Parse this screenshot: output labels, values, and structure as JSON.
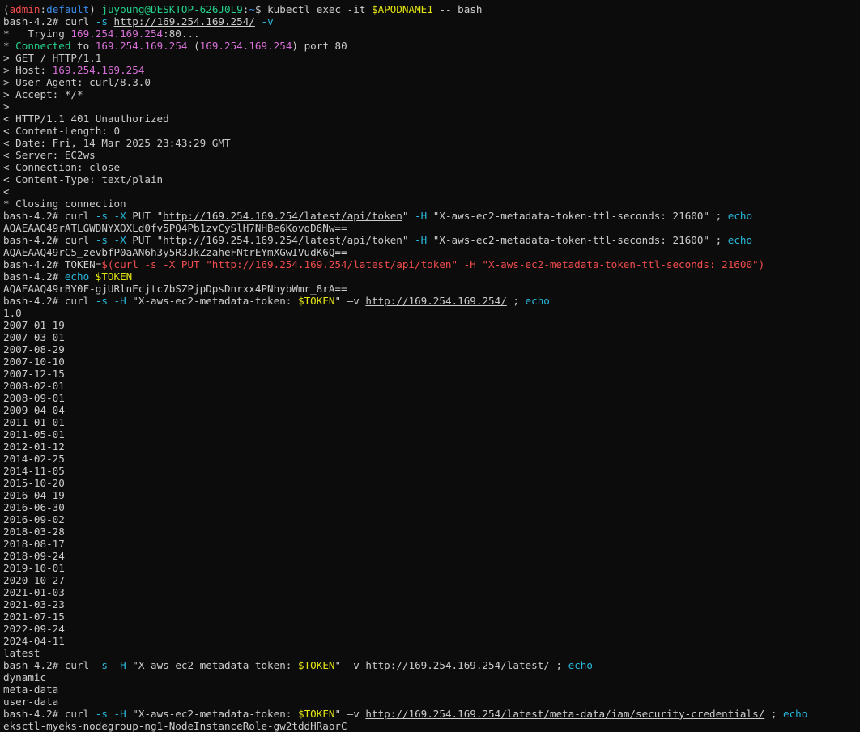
{
  "terminal": {
    "lines": [
      [
        {
          "t": "(",
          "c": "default"
        },
        {
          "t": "admin",
          "c": "red"
        },
        {
          "t": ":",
          "c": "default"
        },
        {
          "t": "default",
          "c": "cyan"
        },
        {
          "t": ") ",
          "c": "default"
        },
        {
          "t": "juyoung@DESKTOP-626J0L9",
          "c": "green"
        },
        {
          "t": ":",
          "c": "default"
        },
        {
          "t": "~",
          "c": "cyan"
        },
        {
          "t": "$ kubectl exec -it ",
          "c": "default"
        },
        {
          "t": "$APODNAME1",
          "c": "yellow"
        },
        {
          "t": " -- bash",
          "c": "default"
        }
      ],
      [
        {
          "t": "bash-4.2# curl ",
          "c": "default"
        },
        {
          "t": "-s",
          "c": "sky"
        },
        {
          "t": " ",
          "c": "default"
        },
        {
          "t": "http://169.254.169.254/",
          "c": "default",
          "u": true
        },
        {
          "t": " ",
          "c": "default"
        },
        {
          "t": "-v",
          "c": "sky"
        }
      ],
      [
        {
          "t": "*   Trying ",
          "c": "default"
        },
        {
          "t": "169.254.169.254",
          "c": "pink"
        },
        {
          "t": ":80...",
          "c": "default"
        }
      ],
      [
        {
          "t": "* ",
          "c": "default"
        },
        {
          "t": "Connected",
          "c": "green"
        },
        {
          "t": " to ",
          "c": "default"
        },
        {
          "t": "169.254.169.254",
          "c": "pink"
        },
        {
          "t": " (",
          "c": "default"
        },
        {
          "t": "169.254.169.254",
          "c": "pink"
        },
        {
          "t": ") port 80",
          "c": "default"
        }
      ],
      [
        {
          "t": "> GET / HTTP/1.1",
          "c": "default"
        }
      ],
      [
        {
          "t": "> Host: ",
          "c": "default"
        },
        {
          "t": "169.254.169.254",
          "c": "pink"
        }
      ],
      [
        {
          "t": "> User-Agent: curl/8.3.0",
          "c": "default"
        }
      ],
      [
        {
          "t": "> Accept: */*",
          "c": "default"
        }
      ],
      [
        {
          "t": ">",
          "c": "default"
        }
      ],
      [
        {
          "t": "< HTTP/1.1 401 Unauthorized",
          "c": "default"
        }
      ],
      [
        {
          "t": "< Content-Length: 0",
          "c": "default"
        }
      ],
      [
        {
          "t": "< Date: Fri, 14 Mar 2025 23:43:29 GMT",
          "c": "default"
        }
      ],
      [
        {
          "t": "< Server: EC2ws",
          "c": "default"
        }
      ],
      [
        {
          "t": "< Connection: close",
          "c": "default"
        }
      ],
      [
        {
          "t": "< Content-Type: text/plain",
          "c": "default"
        }
      ],
      [
        {
          "t": "<",
          "c": "default"
        }
      ],
      [
        {
          "t": "* Closing connection",
          "c": "default"
        }
      ],
      [
        {
          "t": "bash-4.2# curl ",
          "c": "default"
        },
        {
          "t": "-s",
          "c": "sky"
        },
        {
          "t": " ",
          "c": "default"
        },
        {
          "t": "-X",
          "c": "sky"
        },
        {
          "t": " PUT \"",
          "c": "default"
        },
        {
          "t": "http://169.254.169.254/latest/api/token",
          "c": "default",
          "u": true
        },
        {
          "t": "\" ",
          "c": "default"
        },
        {
          "t": "-H",
          "c": "sky"
        },
        {
          "t": " \"X-aws-ec2-metadata-token-ttl-seconds: 21600\" ; ",
          "c": "default"
        },
        {
          "t": "echo",
          "c": "sky"
        }
      ],
      [
        {
          "t": "AQAEAAQ49rATLGWDNYXOXLd0fv5PQ4Pb1zvCySlH7NHBe6KovqD6Nw==",
          "c": "default"
        }
      ],
      [
        {
          "t": "bash-4.2# curl ",
          "c": "default"
        },
        {
          "t": "-s",
          "c": "sky"
        },
        {
          "t": " ",
          "c": "default"
        },
        {
          "t": "-X",
          "c": "sky"
        },
        {
          "t": " PUT \"",
          "c": "default"
        },
        {
          "t": "http://169.254.169.254/latest/api/token",
          "c": "default",
          "u": true
        },
        {
          "t": "\" ",
          "c": "default"
        },
        {
          "t": "-H",
          "c": "sky"
        },
        {
          "t": " \"X-aws-ec2-metadata-token-ttl-seconds: 21600\" ; ",
          "c": "default"
        },
        {
          "t": "echo",
          "c": "sky"
        }
      ],
      [
        {
          "t": "AQAEAAQ49rC5_zevbfP0aAN6h3y5R3JkZzaheFNtrEYmXGwIVudK6Q==",
          "c": "default"
        }
      ],
      [
        {
          "t": "bash-4.2# TOKEN=",
          "c": "default"
        },
        {
          "t": "$(curl -s -X PUT \"http://169.254.169.254/latest/api/token\" -H \"X-aws-ec2-metadata-token-ttl-seconds: 21600\")",
          "c": "red"
        }
      ],
      [
        {
          "t": "bash-4.2# ",
          "c": "default"
        },
        {
          "t": "echo",
          "c": "sky"
        },
        {
          "t": " ",
          "c": "default"
        },
        {
          "t": "$TOKEN",
          "c": "yellow"
        }
      ],
      [
        {
          "t": "AQAEAAQ49rBY0F-gjURlnEcjtc7bSZPjpDpsDnrxx4PNhybWmr_8rA==",
          "c": "default"
        }
      ],
      [
        {
          "t": "bash-4.2# curl ",
          "c": "default"
        },
        {
          "t": "-s",
          "c": "sky"
        },
        {
          "t": " ",
          "c": "default"
        },
        {
          "t": "-H",
          "c": "sky"
        },
        {
          "t": " \"X-aws-ec2-metadata-token: ",
          "c": "default"
        },
        {
          "t": "$TOKEN",
          "c": "yellow"
        },
        {
          "t": "\" —v ",
          "c": "default"
        },
        {
          "t": "http://169.254.169.254/",
          "c": "default",
          "u": true
        },
        {
          "t": " ; ",
          "c": "default"
        },
        {
          "t": "echo",
          "c": "sky"
        }
      ],
      [
        {
          "t": "1.0",
          "c": "default"
        }
      ],
      [
        {
          "t": "2007-01-19",
          "c": "default"
        }
      ],
      [
        {
          "t": "2007-03-01",
          "c": "default"
        }
      ],
      [
        {
          "t": "2007-08-29",
          "c": "default"
        }
      ],
      [
        {
          "t": "2007-10-10",
          "c": "default"
        }
      ],
      [
        {
          "t": "2007-12-15",
          "c": "default"
        }
      ],
      [
        {
          "t": "2008-02-01",
          "c": "default"
        }
      ],
      [
        {
          "t": "2008-09-01",
          "c": "default"
        }
      ],
      [
        {
          "t": "2009-04-04",
          "c": "default"
        }
      ],
      [
        {
          "t": "2011-01-01",
          "c": "default"
        }
      ],
      [
        {
          "t": "2011-05-01",
          "c": "default"
        }
      ],
      [
        {
          "t": "2012-01-12",
          "c": "default"
        }
      ],
      [
        {
          "t": "2014-02-25",
          "c": "default"
        }
      ],
      [
        {
          "t": "2014-11-05",
          "c": "default"
        }
      ],
      [
        {
          "t": "2015-10-20",
          "c": "default"
        }
      ],
      [
        {
          "t": "2016-04-19",
          "c": "default"
        }
      ],
      [
        {
          "t": "2016-06-30",
          "c": "default"
        }
      ],
      [
        {
          "t": "2016-09-02",
          "c": "default"
        }
      ],
      [
        {
          "t": "2018-03-28",
          "c": "default"
        }
      ],
      [
        {
          "t": "2018-08-17",
          "c": "default"
        }
      ],
      [
        {
          "t": "2018-09-24",
          "c": "default"
        }
      ],
      [
        {
          "t": "2019-10-01",
          "c": "default"
        }
      ],
      [
        {
          "t": "2020-10-27",
          "c": "default"
        }
      ],
      [
        {
          "t": "2021-01-03",
          "c": "default"
        }
      ],
      [
        {
          "t": "2021-03-23",
          "c": "default"
        }
      ],
      [
        {
          "t": "2021-07-15",
          "c": "default"
        }
      ],
      [
        {
          "t": "2022-09-24",
          "c": "default"
        }
      ],
      [
        {
          "t": "2024-04-11",
          "c": "default"
        }
      ],
      [
        {
          "t": "latest",
          "c": "default"
        }
      ],
      [
        {
          "t": "bash-4.2# curl ",
          "c": "default"
        },
        {
          "t": "-s",
          "c": "sky"
        },
        {
          "t": " ",
          "c": "default"
        },
        {
          "t": "-H",
          "c": "sky"
        },
        {
          "t": " \"X-aws-ec2-metadata-token: ",
          "c": "default"
        },
        {
          "t": "$TOKEN",
          "c": "yellow"
        },
        {
          "t": "\" —v ",
          "c": "default"
        },
        {
          "t": "http://169.254.169.254/latest/",
          "c": "default",
          "u": true
        },
        {
          "t": " ; ",
          "c": "default"
        },
        {
          "t": "echo",
          "c": "sky"
        }
      ],
      [
        {
          "t": "dynamic",
          "c": "default"
        }
      ],
      [
        {
          "t": "meta-data",
          "c": "default"
        }
      ],
      [
        {
          "t": "user-data",
          "c": "default"
        }
      ],
      [
        {
          "t": "bash-4.2# curl ",
          "c": "default"
        },
        {
          "t": "-s",
          "c": "sky"
        },
        {
          "t": " ",
          "c": "default"
        },
        {
          "t": "-H",
          "c": "sky"
        },
        {
          "t": " \"X-aws-ec2-metadata-token: ",
          "c": "default"
        },
        {
          "t": "$TOKEN",
          "c": "yellow"
        },
        {
          "t": "\" —v ",
          "c": "default"
        },
        {
          "t": "http://169.254.169.254/latest/meta-data/iam/security-credentials/",
          "c": "default",
          "u": true
        },
        {
          "t": " ; ",
          "c": "default"
        },
        {
          "t": "echo",
          "c": "sky"
        }
      ],
      [
        {
          "t": "eksctl-myeks-nodegroup-ng1-NodeInstanceRole-gw2tddHRaorC",
          "c": "default"
        }
      ]
    ]
  }
}
